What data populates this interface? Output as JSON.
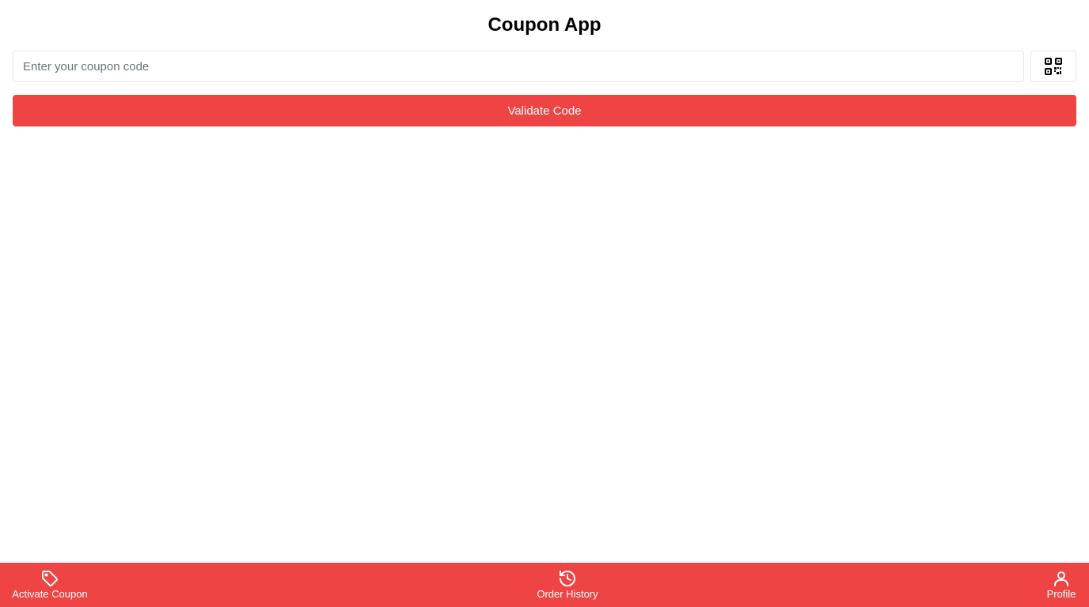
{
  "app": {
    "title": "Coupon App"
  },
  "coupon": {
    "placeholder": "Enter your coupon code",
    "value": "",
    "scan_icon": "qr-code-icon"
  },
  "validate": {
    "label": "Validate Code"
  },
  "bottom_nav": {
    "items": [
      {
        "label": "Activate Coupon",
        "icon": "tag-icon"
      },
      {
        "label": "Order History",
        "icon": "history-icon"
      },
      {
        "label": "Profile",
        "icon": "user-icon"
      }
    ]
  },
  "colors": {
    "accent": "#ef4444",
    "text": "#000000",
    "border": "#e5e7eb",
    "placeholder": "#6b7280"
  }
}
